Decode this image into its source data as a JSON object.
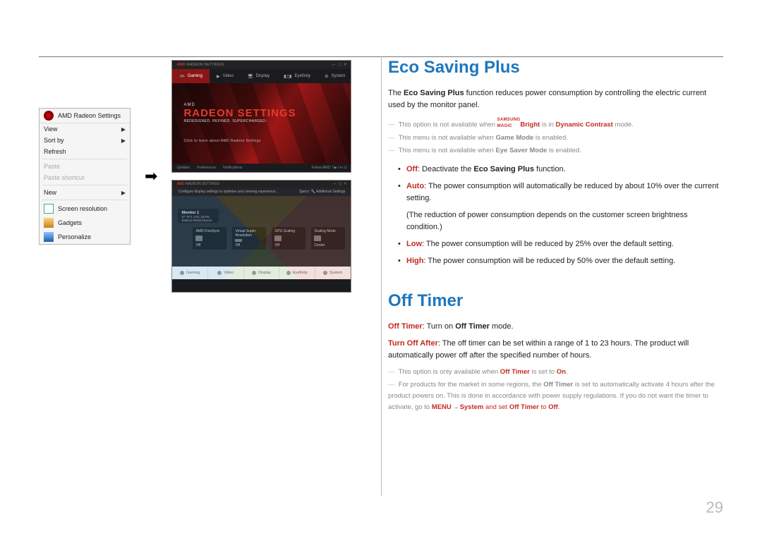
{
  "page_number": "29",
  "left": {
    "context_menu": {
      "title": "AMD Radeon Settings",
      "items": [
        "View",
        "Sort by",
        "Refresh",
        "Paste",
        "Paste shortcut",
        "New",
        "Screen resolution",
        "Gadgets",
        "Personalize"
      ]
    },
    "screenshot1": {
      "window_title": "RADEON SETTINGS",
      "top_tabs": [
        "Gaming",
        "Video",
        "Display",
        "Eyefinity",
        "System"
      ],
      "brand_small": "AMD",
      "headline": "RADEON SETTINGS",
      "subline": "REDESIGNED. REFINED. SUPERCHARGED.",
      "tip": "Click to learn about AMD Radeon Settings",
      "bottom_left": [
        "Updates",
        "Preferences",
        "Notifications"
      ],
      "bottom_right": "Follow AMD"
    },
    "screenshot2": {
      "window_title": "RADEON SETTINGS",
      "sub_left": "Configure display settings to optimize your viewing experience...",
      "sub_right": [
        "Specs",
        "Additional Settings"
      ],
      "monitor_label": "Monitor 1",
      "monitor_detail": "27\" FF1, AOC Q2781 Radeon #5150 Seven2",
      "tiles": [
        {
          "title": "AMD FreeSync",
          "value": "Off"
        },
        {
          "title": "Virtual Super Resolution",
          "value": "Off"
        },
        {
          "title": "GPU Scaling",
          "value": "Off"
        },
        {
          "title": "Scaling Mode",
          "value": "Center"
        }
      ],
      "bottom_tabs": [
        "Gaming",
        "Video",
        "Display",
        "Eyefinity",
        "System"
      ]
    }
  },
  "right": {
    "eco": {
      "heading": "Eco Saving Plus",
      "desc_pre": "The ",
      "desc_bold": "Eco Saving Plus",
      "desc_post": " function reduces power consumption by controlling the electric current used by the monitor panel.",
      "note1_pre": "This option is not available when ",
      "note1_magic_top": "SAMSUNG",
      "note1_magic_bot": "MAGIC",
      "note1_bright": "Bright",
      "note1_mid": " is in ",
      "note1_mode": "Dynamic Contrast",
      "note1_post": " mode.",
      "note2_pre": "This menu is not available when ",
      "note2_bold": "Game Mode",
      "note2_post": " is enabled.",
      "note3_pre": "This menu is not available when ",
      "note3_bold": "Eye Saver Mode",
      "note3_post": " is enabled.",
      "bullets": {
        "off_label": "Off",
        "off_text": ": Deactivate the ",
        "off_bold": "Eco Saving Plus",
        "off_post": " function.",
        "auto_label": "Auto",
        "auto_text": ": The power consumption will automatically be reduced by about 10% over the current setting.",
        "auto_sub": "(The reduction of power consumption depends on the customer screen brightness condition.)",
        "low_label": "Low",
        "low_text": ": The power consumption will be reduced by 25% over the default setting.",
        "high_label": "High",
        "high_text": ": The power consumption will be reduced by 50% over the default setting."
      }
    },
    "off_timer": {
      "heading": "Off Timer",
      "line1_bold1": "Off Timer",
      "line1_mid": ": Turn on ",
      "line1_bold2": "Off Timer",
      "line1_post": " mode.",
      "line2_bold": "Turn Off After",
      "line2_text": ": The off timer can be set within a range of 1 to 23 hours. The product will automatically power off after the specified number of hours.",
      "note1_pre": "This option is only available when ",
      "note1_bold": "Off Timer",
      "note1_mid": " is set to ",
      "note1_val": "On",
      "note1_post": ".",
      "note2_pre": "For products for the market in some regions, the ",
      "note2_bold1": "Off Timer",
      "note2_mid1": " is set to automatically activate 4 hours after the product powers on. This is done in accordance with power supply regulations. If you do not want the timer to activate, go to ",
      "note2_menu": "MENU",
      "note2_arrow": " → ",
      "note2_system": "System",
      "note2_mid2": " and set ",
      "note2_bold2": "Off Timer",
      "note2_mid3": " to ",
      "note2_off": "Off",
      "note2_post": "."
    }
  }
}
